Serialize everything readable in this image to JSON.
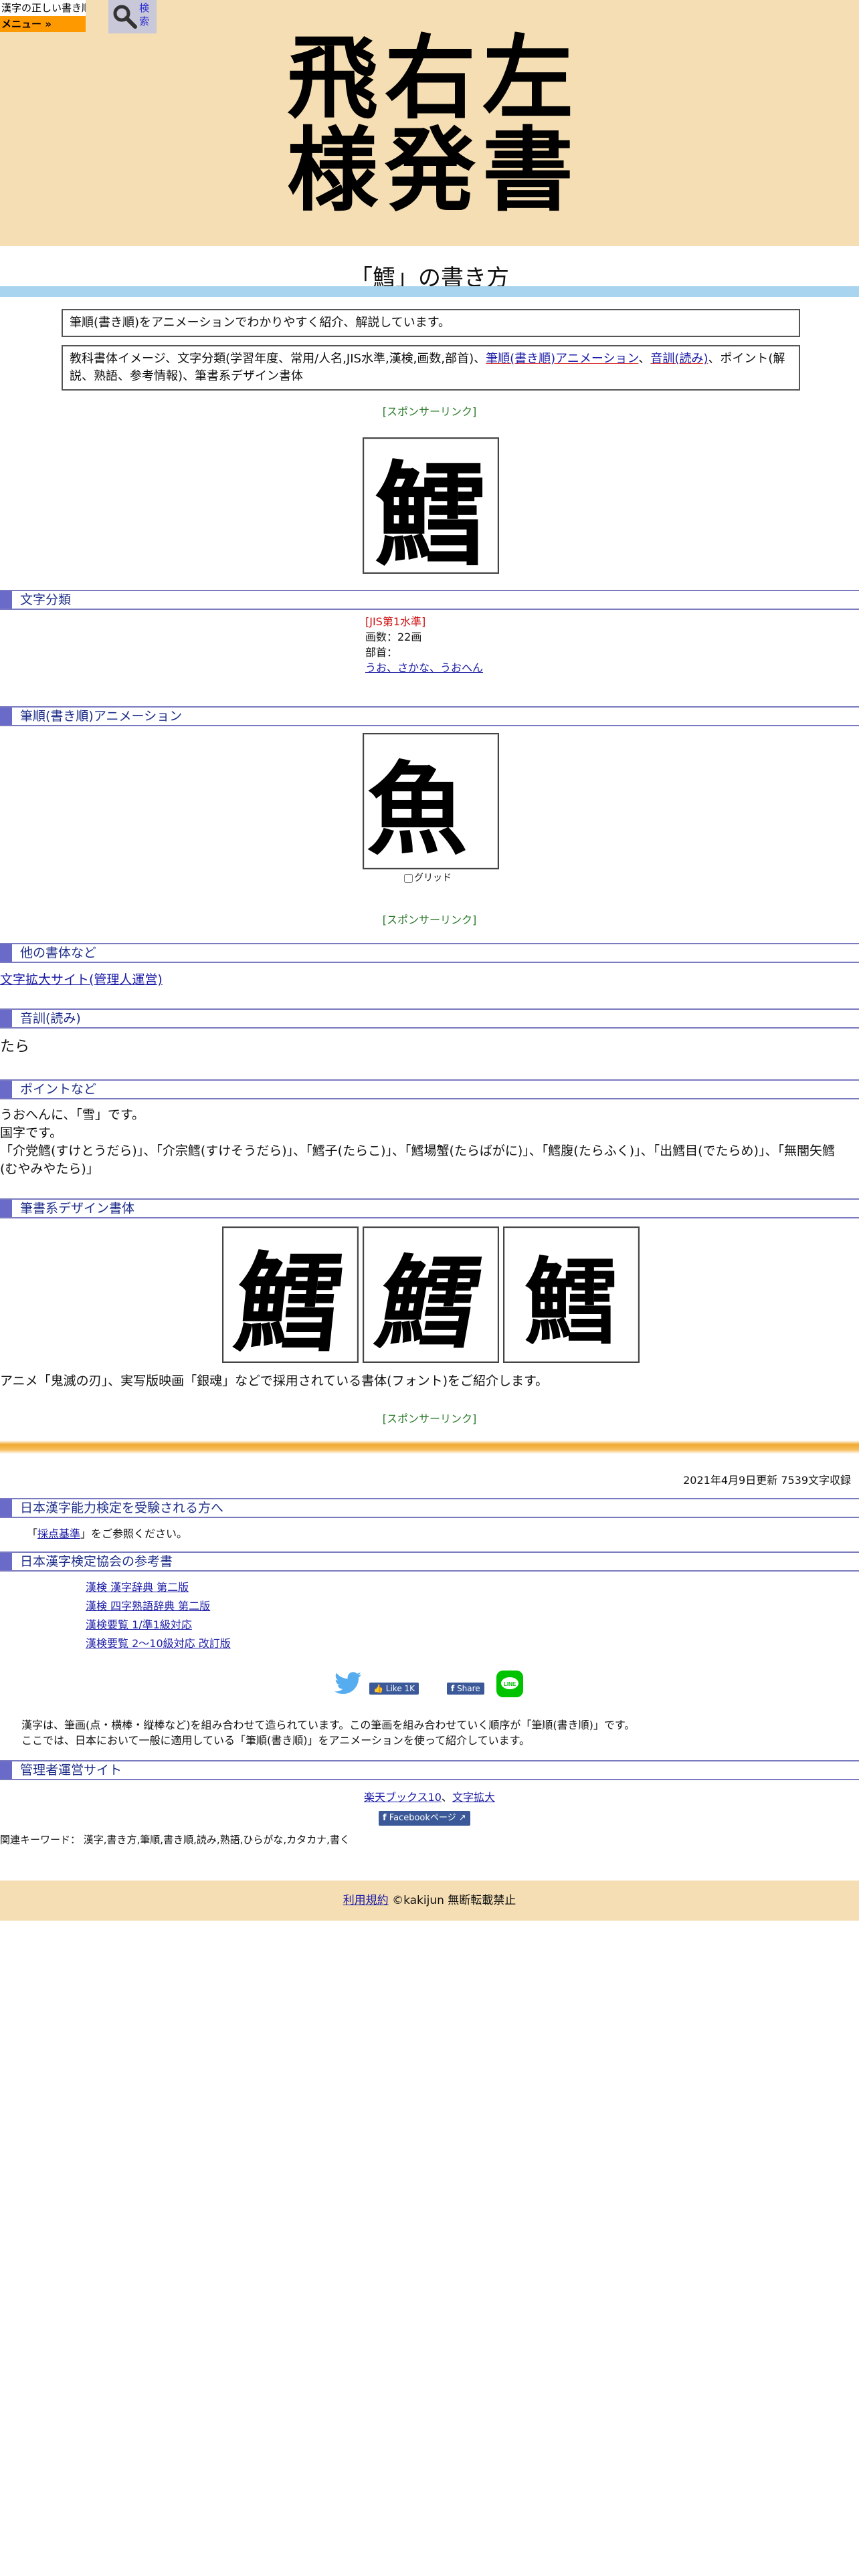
{
  "header": {
    "site_logo_text": "漢字の正しい書き順(筆順)",
    "menu_label": "メニュー »",
    "search_label": "検索",
    "hero_lines": [
      "飛右左",
      "様発書"
    ]
  },
  "page_title": "「鱈」の書き方",
  "intro_box": "筆順(書き順)をアニメーションでわかりやすく紹介、解説しています。",
  "toc_box": {
    "text1": "教科書体イメージ、文字分類(学習年度、常用/人名,JIS水準,漢検,画数,部首)、",
    "link1": "筆順(書き順)アニメーション",
    "sep": "、",
    "link2": "音訓(読み)",
    "text2": "、ポイント(解説、熟語、参考情報)、筆書系デザイン書体"
  },
  "sponsor_label": "[スポンサーリンク]",
  "kanji": "鱈",
  "sections": {
    "classification": "文字分類",
    "animation": "筆順(書き順)アニメーション",
    "other_styles": "他の書体など",
    "reading": "音訓(読み)",
    "points": "ポイントなど",
    "brush_fonts": "筆書系デザイン書体",
    "kentei_takers": "日本漢字能力検定を受験される方へ",
    "kentei_refs": "日本漢字検定協会の参考書",
    "admin_sites": "管理者運営サイト"
  },
  "classification": {
    "jis": "[JIS第1水準]",
    "strokes": "画数：22画",
    "radical_label": "部首：",
    "radical_link": "うお、さかな、うおへん"
  },
  "animation": {
    "frame_char": "魚",
    "grid_label": "グリッド",
    "grid_checked": false
  },
  "other_styles_link": "文字拡大サイト(管理人運営)",
  "reading": "たら",
  "points": {
    "line1": "うおへんに、「雪」です。",
    "line2": "国字です。",
    "line3": "「介党鱈(すけとうだら)」、「介宗鱈(すけそうだら)」、「鱈子(たらこ)」、「鱈場蟹(たらばがに)」、「鱈腹(たらふく)」、「出鱈目(でたらめ)」、「無闇矢鱈(むやみやたら)」"
  },
  "brush_fonts_note": "アニメ「鬼滅の刃」、実写版映画「銀魂」などで採用されている書体(フォント)をご紹介します。",
  "update_info": "2021年4月9日更新 7539文字収録",
  "kentei_note": {
    "prefix": "「",
    "link": "採点基準",
    "suffix": "」をご参照ください。"
  },
  "kentei_refs": [
    "漢検 漢字辞典 第二版",
    "漢検 四字熟語辞典 第二版",
    "漢検要覧 1/準1級対応",
    "漢検要覧 2～10級対応 改訂版"
  ],
  "social": {
    "like_label": "Like 1K",
    "share_label": "Share"
  },
  "explanation": {
    "line1": "漢字は、筆画(点・横棒・縦棒など)を組み合わせて造られています。この筆画を組み合わせていく順序が「筆順(書き順)」です。",
    "line2": "ここでは、日本において一般に適用している「筆順(書き順)」をアニメーションを使って紹介しています。"
  },
  "admin_sites": {
    "link1": "楽天ブックス10",
    "sep": "、",
    "link2": "文字拡大",
    "fb_page_label": "Facebookページ"
  },
  "keywords": "関連キーワード： 漢字,書き方,筆順,書き順,読み,熟語,ひらがな,カタカナ,書く",
  "footer": {
    "terms_link": "利用規約",
    "copyright": "©kakijun 無断転載禁止"
  },
  "colors": {
    "banner_bg": "#f5deb3",
    "menu_orange": "#ff9900",
    "section_accent": "#6a6ac8",
    "title_bar": "#a8d4f0",
    "sponsor_green": "#2a7a2a",
    "jis_red": "#cc1111"
  }
}
